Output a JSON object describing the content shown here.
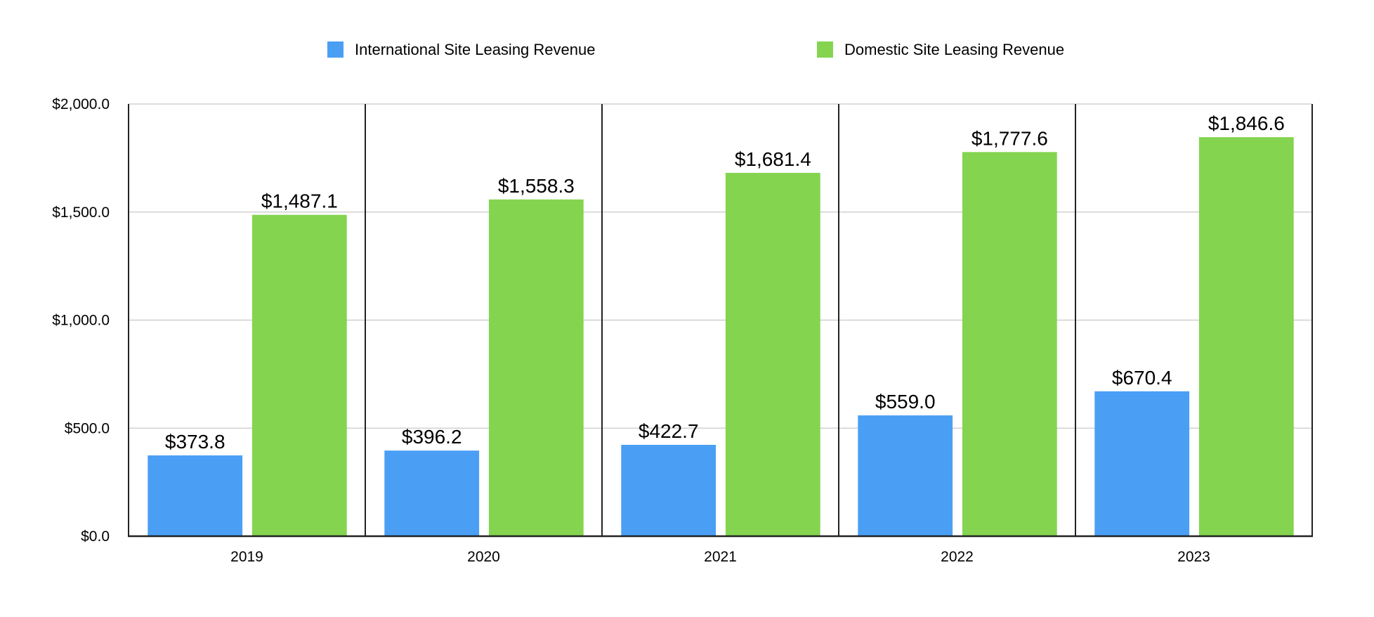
{
  "chart_data": {
    "type": "bar",
    "title": "",
    "xlabel": "",
    "ylabel": "",
    "categories": [
      "2019",
      "2020",
      "2021",
      "2022",
      "2023"
    ],
    "series": [
      {
        "name": "International Site Leasing Revenue",
        "color": "#4A9FF5",
        "values": [
          373.8,
          396.2,
          422.7,
          559.0,
          670.4
        ],
        "labels": [
          "$373.8",
          "$396.2",
          "$422.7",
          "$559.0",
          "$670.4"
        ]
      },
      {
        "name": "Domestic Site Leasing Revenue",
        "color": "#84D450",
        "values": [
          1487.1,
          1558.3,
          1681.4,
          1777.6,
          1846.6
        ],
        "labels": [
          "$1,487.1",
          "$1,558.3",
          "$1,681.4",
          "$1,777.6",
          "$1,846.6"
        ]
      }
    ],
    "ylim": [
      0,
      2000
    ],
    "yticks": [
      0,
      500,
      1000,
      1500,
      2000
    ],
    "ytick_labels": [
      "$0.0",
      "$500.0",
      "$1,000.0",
      "$1,500.0",
      "$2,000.0"
    ],
    "grid": true,
    "legend_position": "top-center"
  }
}
